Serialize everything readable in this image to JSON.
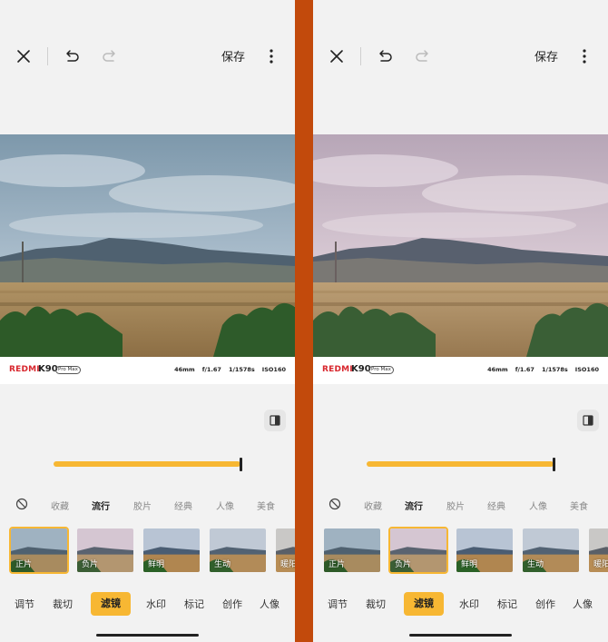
{
  "colors": {
    "divider": "#c24a0c",
    "accent": "#f7b733",
    "panel_bg": "#f2f2f2",
    "brand_red": "#d8262d"
  },
  "panels": [
    {
      "variant": "original",
      "toolbar": {
        "close_icon": "close-icon",
        "undo_icon": "undo-icon",
        "redo_icon": "redo-icon",
        "save_label": "保存",
        "more_icon": "more-vertical-icon"
      },
      "watermark": {
        "brand": "REDMI",
        "model": "K90",
        "edition": "Pro Max",
        "specs": [
          "46mm",
          "f/1.67",
          "1/1578s",
          "ISO160"
        ]
      },
      "compare_icon": "compare-icon",
      "intensity": 1.0,
      "filter_categories": [
        "收藏",
        "流行",
        "胶片",
        "经典",
        "人像",
        "美食"
      ],
      "active_category": "流行",
      "filters": [
        "正片",
        "负片",
        "鲜明",
        "生动",
        "暖阳"
      ],
      "selected_filter": "正片",
      "tabs": [
        "调节",
        "裁切",
        "滤镜",
        "水印",
        "标记",
        "创作",
        "人像"
      ],
      "active_tab": "滤镜"
    },
    {
      "variant": "negative",
      "toolbar": {
        "close_icon": "close-icon",
        "undo_icon": "undo-icon",
        "redo_icon": "redo-icon",
        "save_label": "保存",
        "more_icon": "more-vertical-icon"
      },
      "watermark": {
        "brand": "REDMI",
        "model": "K90",
        "edition": "Pro Max",
        "specs": [
          "46mm",
          "f/1.67",
          "1/1578s",
          "ISO160"
        ]
      },
      "compare_icon": "compare-icon",
      "intensity": 1.0,
      "filter_categories": [
        "收藏",
        "流行",
        "胶片",
        "经典",
        "人像",
        "美食"
      ],
      "active_category": "流行",
      "filters": [
        "正片",
        "负片",
        "鲜明",
        "生动",
        "暖阳"
      ],
      "selected_filter": "负片",
      "tabs": [
        "调节",
        "裁切",
        "滤镜",
        "水印",
        "标记",
        "创作",
        "人像"
      ],
      "active_tab": "滤镜"
    }
  ]
}
